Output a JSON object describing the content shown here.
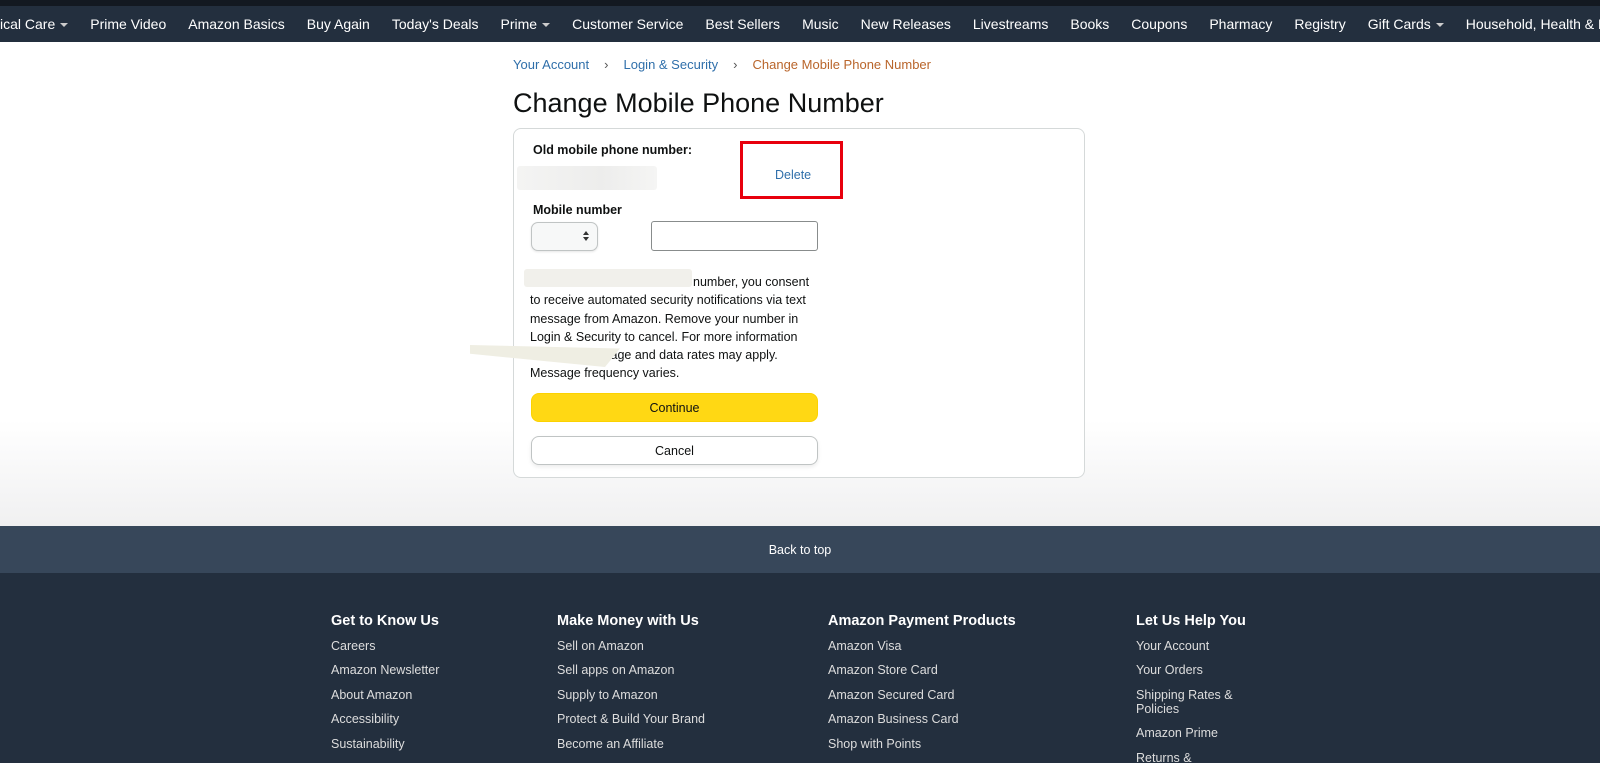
{
  "nav": {
    "items": [
      {
        "label": "ical Care",
        "caret": true
      },
      {
        "label": "Prime Video",
        "caret": false
      },
      {
        "label": "Amazon Basics",
        "caret": false
      },
      {
        "label": "Buy Again",
        "caret": false
      },
      {
        "label": "Today's Deals",
        "caret": false
      },
      {
        "label": "Prime",
        "caret": true
      },
      {
        "label": "Customer Service",
        "caret": false
      },
      {
        "label": "Best Sellers",
        "caret": false
      },
      {
        "label": "Music",
        "caret": false
      },
      {
        "label": "New Releases",
        "caret": false
      },
      {
        "label": "Livestreams",
        "caret": false
      },
      {
        "label": "Books",
        "caret": false
      },
      {
        "label": "Coupons",
        "caret": false
      },
      {
        "label": "Pharmacy",
        "caret": false
      },
      {
        "label": "Registry",
        "caret": false
      },
      {
        "label": "Gift Cards",
        "caret": true
      },
      {
        "label": "Household, Health & Baby Car",
        "caret": false
      }
    ]
  },
  "breadcrumb": {
    "your_account": "Your Account",
    "separator": "›",
    "login_security": "Login & Security",
    "current": "Change Mobile Phone Number"
  },
  "page": {
    "title": "Change Mobile Phone Number",
    "old_label": "Old mobile phone number:",
    "delete_link": "Delete",
    "mobile_label": "Mobile number",
    "phone_value": "",
    "country_value": "",
    "consent_text": "number, you consent to receive automated security notifications via text message from Amazon. Remove your number in Login & Security to cancel. For more information ssage and data rates may apply. Message frequency varies.",
    "consent_lines": [
      "number, you consent",
      "to receive automated security notifications via text",
      "message from Amazon. Remove your number in",
      "Login & Security to cancel. For more information",
      "ssage and data rates may apply.",
      "Message frequency varies."
    ],
    "continue_label": "Continue",
    "cancel_label": "Cancel"
  },
  "footer": {
    "back_to_top": "Back to top",
    "columns": [
      {
        "title": "Get to Know Us",
        "links": [
          "Careers",
          "Amazon Newsletter",
          "About Amazon",
          "Accessibility",
          "Sustainability"
        ]
      },
      {
        "title": "Make Money with Us",
        "links": [
          "Sell on Amazon",
          "Sell apps on Amazon",
          "Supply to Amazon",
          "Protect & Build Your Brand",
          "Become an Affiliate"
        ]
      },
      {
        "title": "Amazon Payment Products",
        "links": [
          "Amazon Visa",
          "Amazon Store Card",
          "Amazon Secured Card",
          "Amazon Business Card",
          "Shop with Points"
        ]
      },
      {
        "title": "Let Us Help You",
        "links": [
          "Your Account",
          "Your Orders",
          "Shipping Rates & Policies",
          "Amazon Prime",
          "Returns &"
        ]
      }
    ]
  },
  "colors": {
    "nav_bg": "#232f3e",
    "link": "#2f6faa",
    "breadcrumb_current": "#b9652b",
    "continue_button": "#ffd814",
    "highlight": "#e8000d",
    "footer_bg": "#232f3e",
    "back_to_top_bg": "#37475a"
  }
}
